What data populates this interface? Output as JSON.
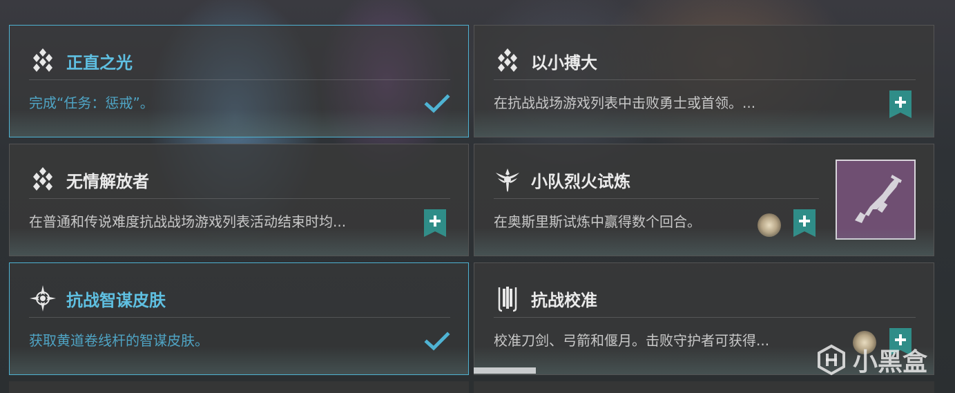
{
  "cards": [
    {
      "title": "正直之光",
      "description": "完成“任务：惩戒”。",
      "icon": "diamond-cluster-icon",
      "status": "completed"
    },
    {
      "title": "以小搏大",
      "description": "在抗战战场游戏列表中击败勇士或首领。...",
      "icon": "diamond-cluster-icon",
      "status": "trackable",
      "track_symbol": "+"
    },
    {
      "title": "无情解放者",
      "description": "在普通和传说难度抗战战场游戏列表活动结束时均...",
      "icon": "diamond-cluster-icon",
      "status": "trackable",
      "track_symbol": "+"
    },
    {
      "title": "小队烈火试炼",
      "description": "在奥斯里斯试炼中赢得数个回合。",
      "icon": "trials-emblem-icon",
      "status": "trackable",
      "track_symbol": "+",
      "reward": "weapon-reward-icon"
    },
    {
      "title": "抗战智谋皮肤",
      "description": "获取黄道卷线杆的智谋皮肤。",
      "icon": "compass-star-icon",
      "status": "completed"
    },
    {
      "title": "抗战校准",
      "description": "校准刀剑、弓箭和偃月。击败守护者可获得...",
      "icon": "weapon-rack-icon",
      "status": "trackable",
      "track_symbol": "+"
    }
  ],
  "watermark": {
    "text": "小黑盒"
  },
  "colors": {
    "completed_accent": "#4fb3d3",
    "track_button": "#2f8d88",
    "reward_bg": "#6f4f72"
  }
}
